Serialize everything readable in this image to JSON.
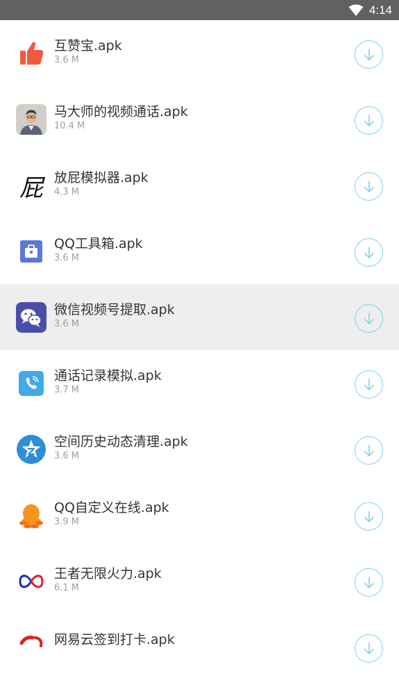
{
  "status_bar": {
    "time": "4:14"
  },
  "colors": {
    "status_bar_bg": "#616161",
    "download_ring": "#7fd2ec",
    "highlight_row": "#eeeeee"
  },
  "apps": [
    {
      "name": "互赞宝.apk",
      "size": "3.6 M",
      "icon": "thumbs-up-icon"
    },
    {
      "name": "马大师的视频通话.apk",
      "size": "10.4 M",
      "icon": "person-photo-icon"
    },
    {
      "name": "放屁模拟器.apk",
      "size": "4.3 M",
      "icon": "calligraphy-character-icon",
      "icon_text": "屁"
    },
    {
      "name": "QQ工具箱.apk",
      "size": "3.6 M",
      "icon": "toolbox-icon"
    },
    {
      "name": "微信视频号提取.apk",
      "size": "3.6 M",
      "icon": "wechat-icon",
      "highlighted": true
    },
    {
      "name": "通话记录模拟.apk",
      "size": "3.7 M",
      "icon": "phone-icon"
    },
    {
      "name": "空间历史动态清理.apk",
      "size": "3.6 M",
      "icon": "qzone-star-icon"
    },
    {
      "name": "QQ自定义在线.apk",
      "size": "3.9 M",
      "icon": "qq-penguin-icon"
    },
    {
      "name": "王者无限火力.apk",
      "size": "6.1 M",
      "icon": "infinity-icon"
    },
    {
      "name": "网易云签到打卡.apk",
      "size": "",
      "icon": "netease-icon"
    }
  ]
}
